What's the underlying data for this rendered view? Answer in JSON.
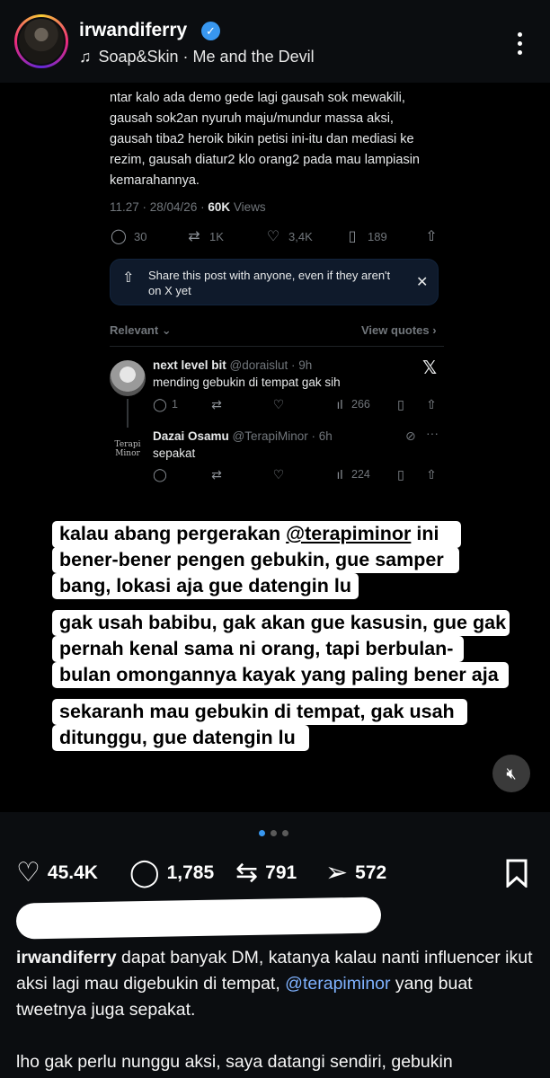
{
  "header": {
    "username": "irwandiferry",
    "verified_mark": "✓",
    "song_icon": "music-note-icon",
    "song": "Soap&Skin · Me and the Devil",
    "more_icon": "more-vertical-icon"
  },
  "tweet": {
    "text": "ntar kalo ada demo gede lagi gausah sok mewakili, gausah sok2an nyuruh maju/mundur massa aksi, gausah tiba2 heroik bikin petisi ini-itu dan mediasi ke rezim, gausah diatur2 klo orang2 pada mau lampiasin kemarahannya.",
    "timestamp": "11.27 · 28/04/26 · ",
    "views_count": "60K",
    "views_label": " Views",
    "replies": "30",
    "reposts": "1K",
    "likes": "3,4K",
    "bookmarks": "189",
    "share_notice": "Share this post with anyone, even if they aren't on X yet",
    "sort_label": "Relevant ⌄",
    "view_quotes": "View quotes ›"
  },
  "replies": [
    {
      "name": "next level bit",
      "handle": " @doraislut · 9h",
      "text": "mending gebukin di tempat gak sih",
      "replies": "1",
      "views": "266"
    },
    {
      "name": "Dazai Osamu",
      "handle": " @TerapiMinor · 6h",
      "text": "sepakat",
      "avatar_text": "Terapi Minor",
      "views": "224"
    }
  ],
  "captions": [
    {
      "lines": [
        "kalau abang pergerakan ",
        "@terapiminor",
        " ini",
        "bener-bener pengen gebukin, gue samper",
        "bang, lokasi aja gue datengin lu"
      ]
    },
    {
      "lines": [
        "gak usah babibu, gak akan gue kasusin, gue gak",
        "pernah kenal sama ni orang, tapi berbulan-",
        "bulan omongannya kayak yang paling bener aja"
      ]
    },
    {
      "lines": [
        "sekaranh mau gebukin di tempat, gak usah",
        "ditunggu, gue datengin lu"
      ]
    }
  ],
  "post": {
    "likes": "45.4K",
    "comments": "1,785",
    "reposts": "791",
    "shares": "572",
    "caption_user": "irwandiferry",
    "caption_part1": " dapat banyak DM, katanya kalau nanti influencer ikut aksi lagi mau digebukin di tempat, ",
    "caption_mention": "@terapiminor",
    "caption_part2": " yang buat tweetnya juga sepakat.",
    "caption_next": "lho gak perlu nunggu aksi, saya datangi sendiri, gebukin"
  },
  "colors": {
    "accent": "#3897f0",
    "mention": "#7fb2ff",
    "x_muted": "#71767b"
  }
}
